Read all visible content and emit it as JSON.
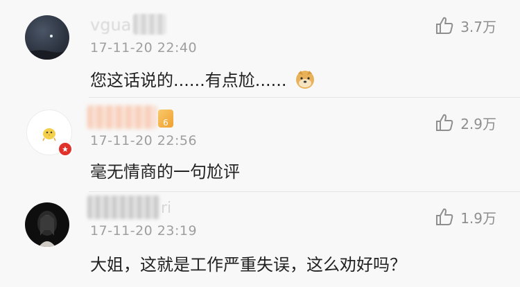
{
  "comments": [
    {
      "username_visible": "vgua",
      "timestamp": "17-11-20 22:40",
      "text": "您这话说的......有点尬......",
      "likes": "3.7万"
    },
    {
      "timestamp": "17-11-20 22:56",
      "text": "毫无情商的一句尬评",
      "likes": "2.9万",
      "level_badge": "6"
    },
    {
      "username_visible": "ri",
      "timestamp": "17-11-20 23:19",
      "text": "大姐，这就是工作严重失误，这么劝好吗？",
      "likes": "1.9万"
    }
  ]
}
